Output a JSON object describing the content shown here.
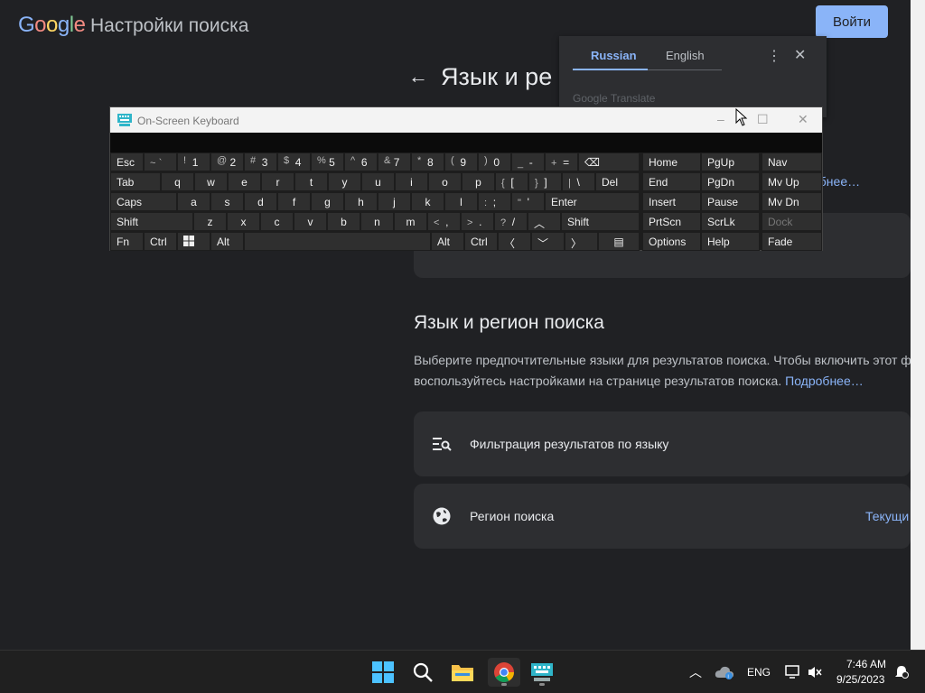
{
  "header": {
    "logo": "Google",
    "title": "Настройки поиска",
    "signin_label": "Войти"
  },
  "page": {
    "heading": "Язык и ре",
    "back_icon": "arrow-left-icon",
    "partial_link": "обнее…"
  },
  "section": {
    "title": "Язык и регион поиска",
    "desc_line1": "Выберите предпочтительные языки для результатов поиска. Чтобы включить этот ф",
    "desc_line2_prefix": "воспользуйтесь настройками на странице результатов поиска. ",
    "desc_link": "Подробнее…",
    "cards": [
      {
        "label": "Фильтрация результатов по языку",
        "icon": "filter-list-icon",
        "value": ""
      },
      {
        "label": "Регион поиска",
        "icon": "globe-icon",
        "value": "Текущи"
      }
    ]
  },
  "translate": {
    "tab_active": "Russian",
    "tab_inactive": "English",
    "brand": "Google Translate",
    "menu_icon": "more-vert-icon",
    "close_icon": "close-icon"
  },
  "osk": {
    "title": "On-Screen Keyboard",
    "minimize": "–",
    "maximize": "☐",
    "close": "✕",
    "row1": [
      "Esc",
      "~",
      "`",
      "!",
      "1",
      "@",
      "2",
      "#",
      "3",
      "$",
      "4",
      "%",
      "5",
      "^",
      "6",
      "&",
      "7",
      "*",
      "8",
      "(",
      "9",
      ")",
      "0",
      "_",
      "-",
      "+",
      "=",
      "⌫"
    ],
    "keys": {
      "esc": "Esc",
      "tab": "Tab",
      "caps": "Caps",
      "shift_l": "Shift",
      "fn": "Fn",
      "ctrl_l": "Ctrl",
      "alt_l": "Alt",
      "alt_r": "Alt",
      "ctrl_r": "Ctrl",
      "shift_r": "Shift",
      "del": "Del",
      "enter": "Enter",
      "home": "Home",
      "pgup": "PgUp",
      "nav": "Nav",
      "end": "End",
      "pgdn": "PgDn",
      "mvup": "Mv Up",
      "insert": "Insert",
      "pause": "Pause",
      "mvdn": "Mv Dn",
      "prtscn": "PrtScn",
      "scrlk": "ScrLk",
      "dock": "Dock",
      "options": "Options",
      "help": "Help",
      "fade": "Fade"
    },
    "qrow": [
      "q",
      "w",
      "e",
      "r",
      "t",
      "y",
      "u",
      "i",
      "o",
      "p"
    ],
    "arow": [
      "a",
      "s",
      "d",
      "f",
      "g",
      "h",
      "j",
      "k",
      "l"
    ],
    "zrow": [
      "z",
      "x",
      "c",
      "v",
      "b",
      "n",
      "m"
    ]
  },
  "taskbar": {
    "icons": [
      "windows-start-icon",
      "search-icon",
      "file-explorer-icon",
      "chrome-icon",
      "on-screen-keyboard-icon"
    ],
    "lang": "ENG",
    "time": "7:46 AM",
    "date": "9/25/2023"
  }
}
